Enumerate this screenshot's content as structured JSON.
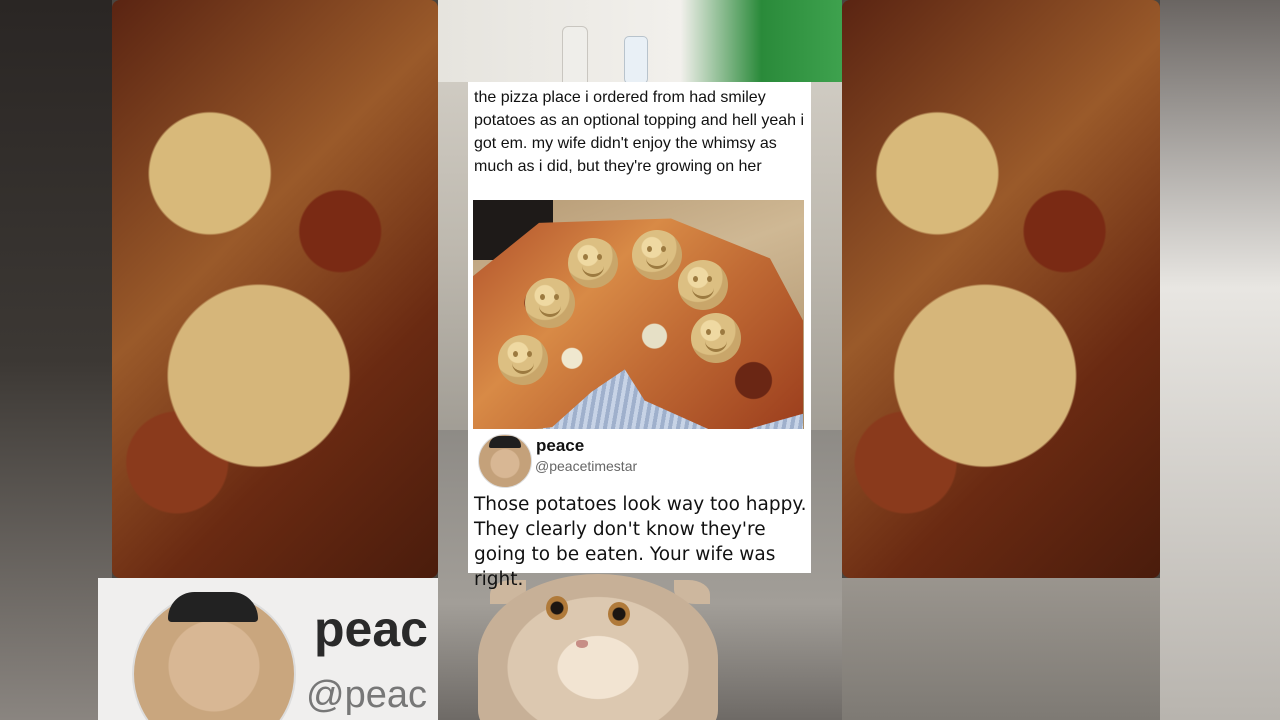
{
  "post": {
    "text": "the pizza place i ordered from had smiley potatoes as an optional topping and hell yeah i got em. my wife didn't enjoy the whimsy as much as i did, but they're growing on her",
    "photo_icon": "pizza-with-smiley-potatoes"
  },
  "reply": {
    "name": "peace",
    "handle": "@peacetimestar",
    "text": "Those potatoes look way too happy. They clearly don't know they're going to be eaten. Your wife was right.",
    "avatar_icon": "cat-avatar"
  },
  "background": {
    "zoomed_name": "peac",
    "zoomed_handle": "@peac"
  },
  "colors": {
    "card": "#ffffff",
    "text": "#111111",
    "handle": "#666666"
  }
}
